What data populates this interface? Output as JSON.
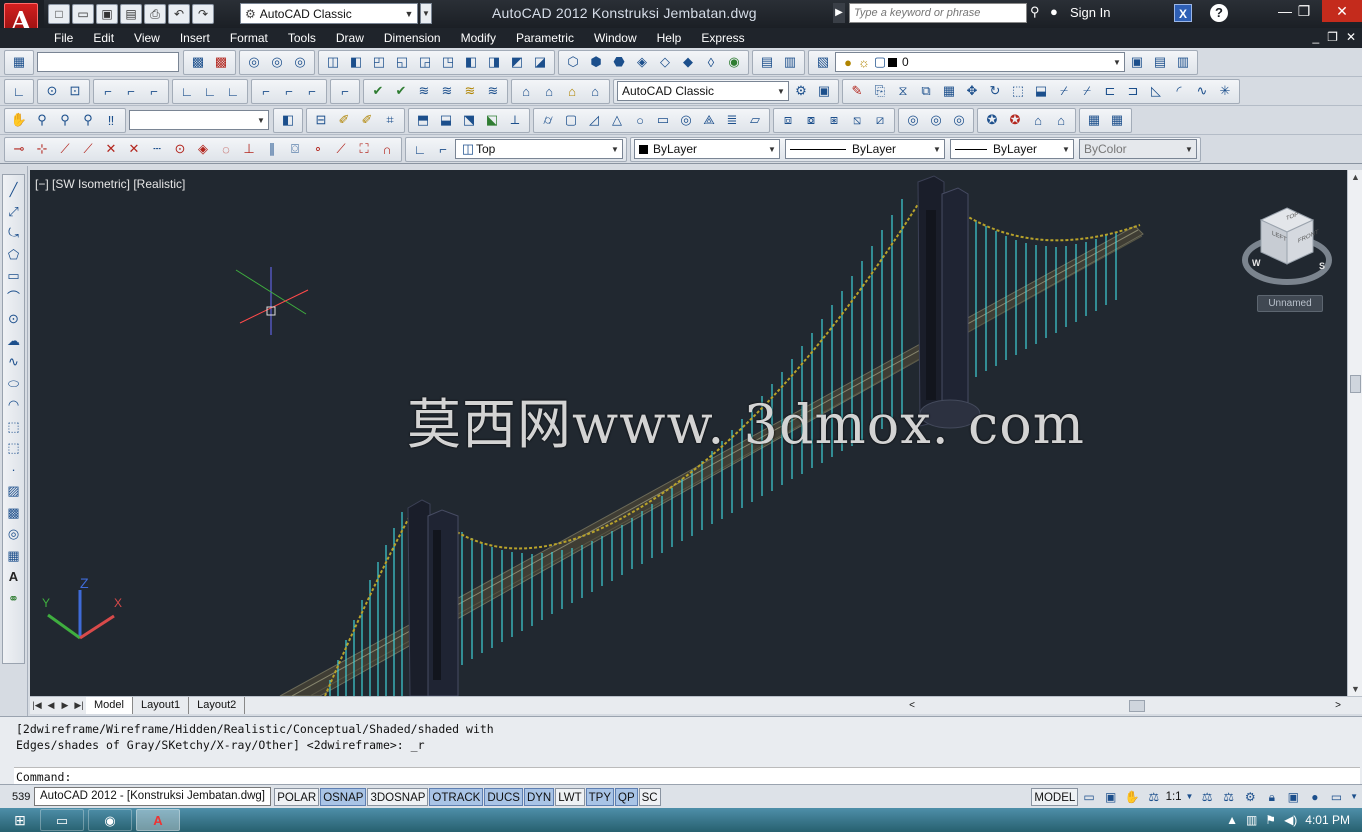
{
  "app": {
    "logo_letter": "A",
    "title": "AutoCAD 2012    Konstruksi Jembatan.dwg",
    "workspace": "AutoCAD Classic"
  },
  "search": {
    "placeholder": "Type a keyword or phrase"
  },
  "signin": {
    "label": "Sign In"
  },
  "menus": [
    "File",
    "Edit",
    "View",
    "Insert",
    "Format",
    "Tools",
    "Draw",
    "Dimension",
    "Modify",
    "Parametric",
    "Window",
    "Help",
    "Express"
  ],
  "toolbar": {
    "layer_name": "0",
    "text_style": "AutoCAD Classic",
    "view_name": "Top",
    "color": "ByLayer",
    "linetype": "ByLayer",
    "lineweight": "ByLayer",
    "plotstyle": "ByColor"
  },
  "viewport": {
    "label": "[−] [SW Isometric] [Realistic]",
    "watermark": "莫西网www. 3dmox. com",
    "viewcube_faces": {
      "top": "TOP",
      "left": "LEFT",
      "front": "FRONT"
    },
    "compass": {
      "w": "W",
      "s": "S"
    },
    "ucs_name": "Unnamed",
    "axes": {
      "x": "X",
      "y": "Y",
      "z": "Z"
    }
  },
  "tabs": [
    "Model",
    "Layout1",
    "Layout2"
  ],
  "command": {
    "history_line1": "[2dwireframe/Wireframe/Hidden/Realistic/Conceptual/Shaded/shaded with",
    "history_line2": "Edges/shades of Gray/SKetchy/X-ray/Other] <2dwireframe>: _r",
    "prompt": "Command:"
  },
  "status": {
    "coords": "539",
    "taskbar_tooltip": "AutoCAD 2012 - [Konstruksi Jembatan.dwg]",
    "toggles": [
      "POLAR",
      "OSNAP",
      "3DOSNAP",
      "OTRACK",
      "DUCS",
      "DYN",
      "LWT",
      "TPY",
      "QP",
      "SC"
    ],
    "toggles_on": [
      "OSNAP",
      "OTRACK",
      "DUCS",
      "DYN",
      "TPY",
      "QP"
    ],
    "space": "MODEL",
    "annotation_scale": "1:1"
  },
  "taskbar": {
    "clock": "4:01 PM"
  },
  "colors": {
    "viewport_bg": "#212830",
    "cable": "#b8a22a",
    "hanger": "#3fd0d8",
    "tower": "#1a1e2a",
    "deck": "#3f3d34"
  }
}
